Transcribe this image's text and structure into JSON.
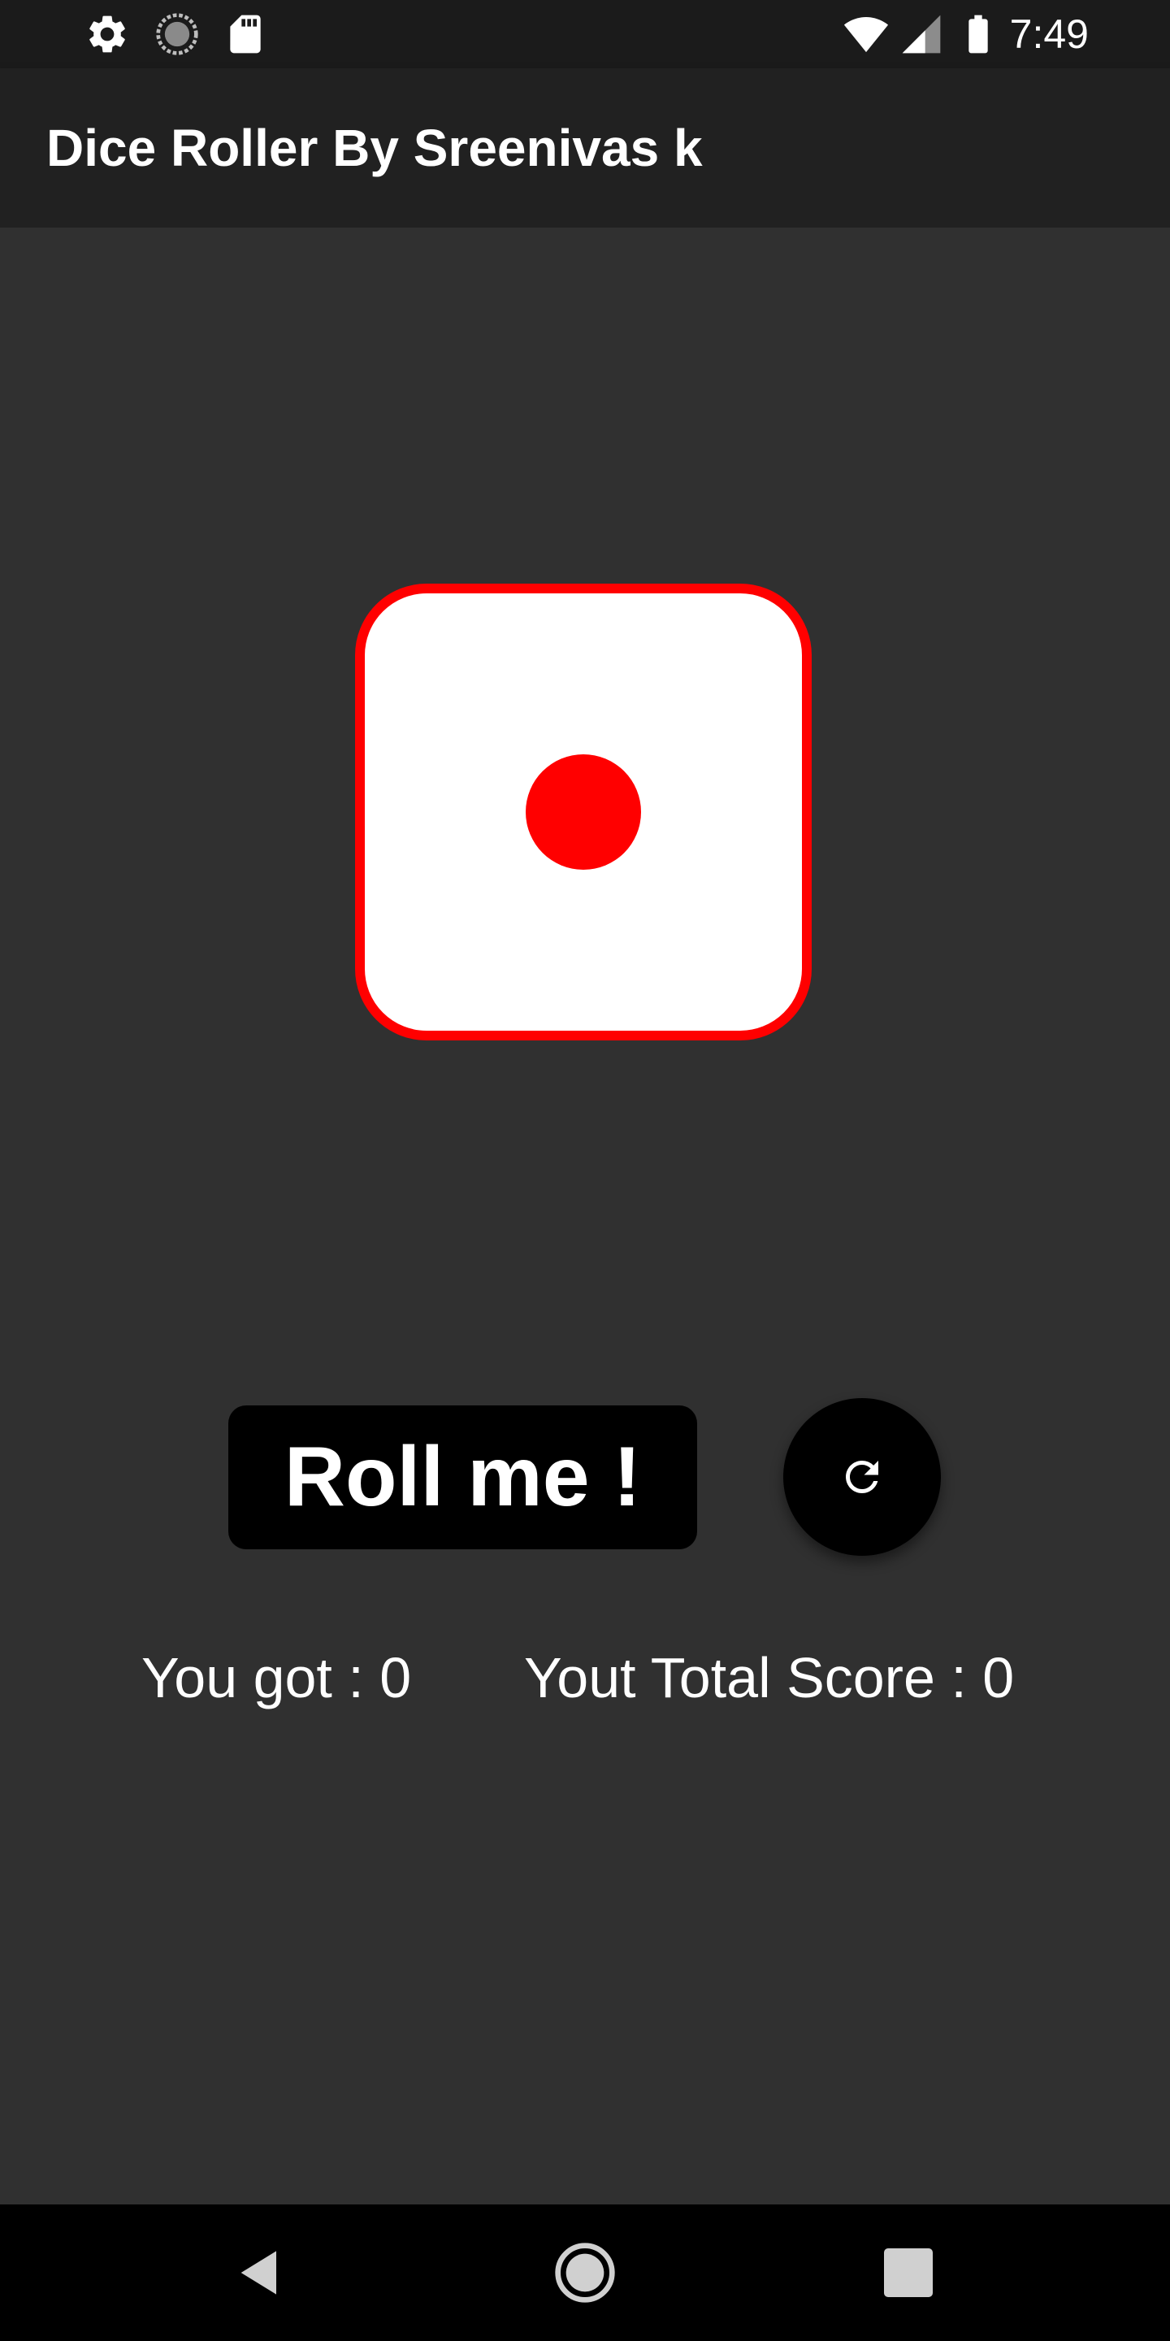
{
  "status_bar": {
    "time": "7:49",
    "icons": [
      "gear-icon",
      "loading-icon",
      "sd-card-icon",
      "wifi-icon",
      "signal-icon",
      "battery-icon"
    ]
  },
  "app_bar": {
    "title": "Dice Roller By Sreenivas k"
  },
  "dice": {
    "face_value": 1,
    "face_color": "#ffffff",
    "border_color": "#ff0000",
    "pip_color": "#ff0000"
  },
  "controls": {
    "roll_label": "Roll me !",
    "reset_icon": "refresh-icon"
  },
  "scores": {
    "you_got": "You got : 0",
    "total_score": "Yout Total Score : 0"
  },
  "nav_bar": {
    "icons": [
      "back-icon",
      "home-icon",
      "recents-icon"
    ]
  },
  "colors": {
    "background": "#303030",
    "app_bar": "#212121",
    "status_bar": "#1b1b1b",
    "button": "#000000",
    "accent": "#ff0000"
  }
}
